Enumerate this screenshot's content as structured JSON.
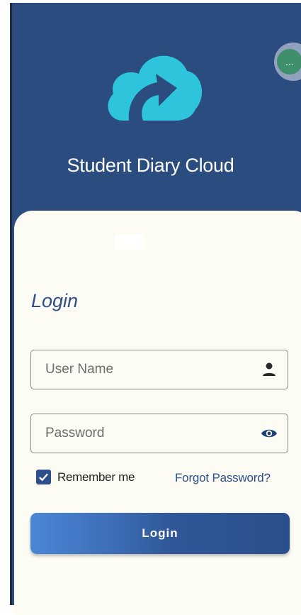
{
  "app": {
    "title": "Student Diary Cloud",
    "logo_icon": "cloud-arrow-icon",
    "colors": {
      "header_bg": "#2b4c7e",
      "card_bg": "#fdfcf4",
      "accent": "#2d4f8e",
      "logo": "#2ec4dc",
      "button_start": "#4b86d6",
      "button_end": "#2a4f8c"
    }
  },
  "floating_bubble": {
    "label": "...",
    "icon": "more-dots-icon"
  },
  "login": {
    "heading": "Login",
    "username": {
      "value": "",
      "placeholder": "User Name",
      "icon": "person-icon"
    },
    "password": {
      "value": "",
      "placeholder": "Password",
      "icon": "eye-icon"
    },
    "remember_me": {
      "label": "Remember me",
      "checked": true
    },
    "forgot_password": "Forgot Password?",
    "submit_label": "Login"
  }
}
